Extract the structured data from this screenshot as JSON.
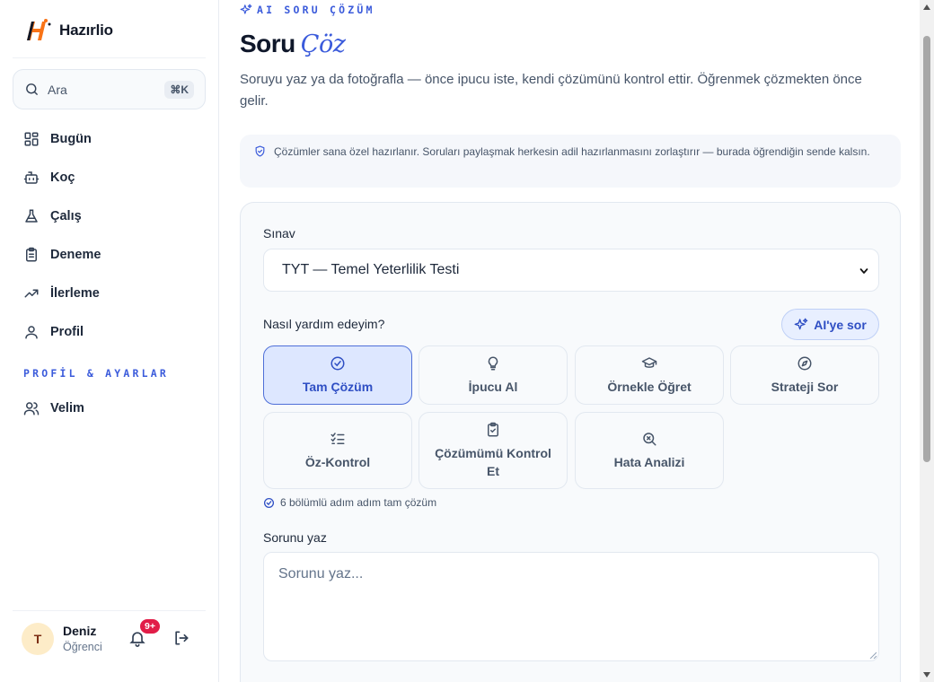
{
  "brand": {
    "name": "Hazırlio"
  },
  "search": {
    "label": "Ara",
    "shortcut": "⌘K"
  },
  "sidebar": {
    "items": [
      {
        "label": "Bugün",
        "icon": "grid-icon"
      },
      {
        "label": "Koç",
        "icon": "robot-icon"
      },
      {
        "label": "Çalış",
        "icon": "flask-icon"
      },
      {
        "label": "Deneme",
        "icon": "clipboard-icon"
      },
      {
        "label": "İlerleme",
        "icon": "trending-up-icon"
      },
      {
        "label": "Profil",
        "icon": "user-icon"
      }
    ],
    "section_title": "PROFİL & AYARLAR",
    "section_items": [
      {
        "label": "Velim",
        "icon": "users-icon"
      }
    ]
  },
  "user": {
    "initial": "T",
    "name": "Deniz",
    "role": "Öğrenci",
    "notification_count": "9+"
  },
  "page": {
    "eyebrow": "AI SORU ÇÖZÜM",
    "title": "Soru",
    "title_accent": "Çöz",
    "subtitle": "Soruyu yaz ya da fotoğrafla — önce ipucu iste, kendi çözümünü kontrol ettir. Öğrenmek çözmekten önce gelir.",
    "notice": "Çözümler sana özel hazırlanır. Soruları paylaşmak herkesin adil hazırlanmasını zorlaştırır — burada öğrendiğin sende kalsın."
  },
  "form": {
    "exam_label": "Sınav",
    "exam_value": "TYT — Temel Yeterlilik Testi",
    "help_label": "Nasıl yardım edeyim?",
    "ask_ai_label": "AI'ye sor",
    "modes": [
      {
        "label": "Tam Çözüm",
        "icon": "check-circle-icon",
        "active": true
      },
      {
        "label": "İpucu Al",
        "icon": "lightbulb-icon",
        "active": false
      },
      {
        "label": "Örnekle Öğret",
        "icon": "graduation-cap-icon",
        "active": false
      },
      {
        "label": "Strateji Sor",
        "icon": "compass-icon",
        "active": false
      },
      {
        "label": "Öz-Kontrol",
        "icon": "checklist-icon",
        "active": false
      },
      {
        "label": "Çözümümü Kontrol Et",
        "icon": "clipboard-check-icon",
        "active": false
      },
      {
        "label": "Hata Analizi",
        "icon": "search-x-icon",
        "active": false
      }
    ],
    "mode_hint": "6 bölümlü adım adım tam çözüm",
    "question_label": "Sorunu yaz",
    "question_placeholder": "Sorunu yaz..."
  },
  "colors": {
    "accent": "#3b5bdb",
    "active_bg": "#dde7ff",
    "badge": "#e11d48",
    "logo_orange": "#f97316"
  }
}
